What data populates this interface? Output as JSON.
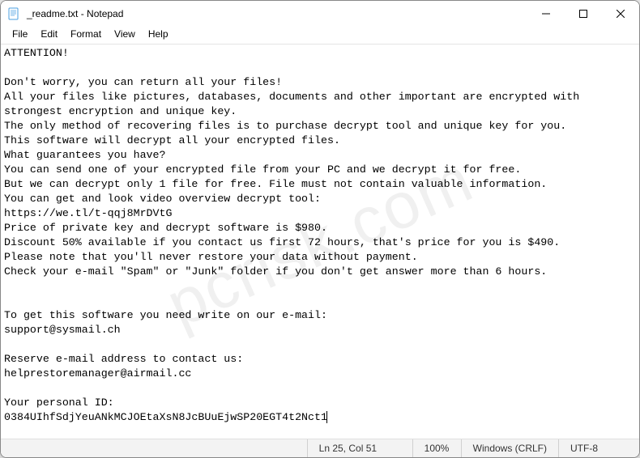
{
  "titlebar": {
    "title": "_readme.txt - Notepad"
  },
  "menubar": {
    "file": "File",
    "edit": "Edit",
    "format": "Format",
    "view": "View",
    "help": "Help"
  },
  "content": {
    "text": "ATTENTION!\n\nDon't worry, you can return all your files!\nAll your files like pictures, databases, documents and other important are encrypted with strongest encryption and unique key.\nThe only method of recovering files is to purchase decrypt tool and unique key for you.\nThis software will decrypt all your encrypted files.\nWhat guarantees you have?\nYou can send one of your encrypted file from your PC and we decrypt it for free.\nBut we can decrypt only 1 file for free. File must not contain valuable information.\nYou can get and look video overview decrypt tool:\nhttps://we.tl/t-qqj8MrDVtG\nPrice of private key and decrypt software is $980.\nDiscount 50% available if you contact us first 72 hours, that's price for you is $490.\nPlease note that you'll never restore your data without payment.\nCheck your e-mail \"Spam\" or \"Junk\" folder if you don't get answer more than 6 hours.\n\n\nTo get this software you need write on our e-mail:\nsupport@sysmail.ch\n\nReserve e-mail address to contact us:\nhelprestoremanager@airmail.cc\n\nYour personal ID:\n0384UIhfSdjYeuANkMCJOEtaXsN8JcBUuEjwSP20EGT4t2Nct1"
  },
  "statusbar": {
    "cursor": "Ln 25, Col 51",
    "zoom": "100%",
    "lineending": "Windows (CRLF)",
    "encoding": "UTF-8"
  },
  "watermark": "pcrisk.com"
}
